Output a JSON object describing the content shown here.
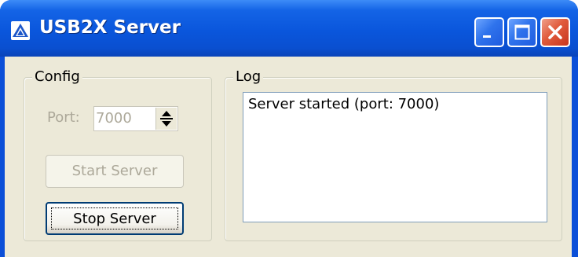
{
  "window": {
    "title": "USB2X Server"
  },
  "config": {
    "legend": "Config",
    "port_label": "Port:",
    "port_value": "7000",
    "start_button": "Start Server",
    "stop_button": "Stop Server"
  },
  "log": {
    "legend": "Log",
    "lines": [
      "Server started (port: 7000)"
    ]
  },
  "icons": {
    "app": "app-logo-icon",
    "minimize": "minimize-icon",
    "maximize": "maximize-icon",
    "close": "close-icon",
    "spinner": "spinner-arrows-icon"
  },
  "colors": {
    "titlebar": "#0a56dc",
    "client_bg": "#ece9d8",
    "close_button": "#e05b3c",
    "disabled_text": "#aca899"
  }
}
